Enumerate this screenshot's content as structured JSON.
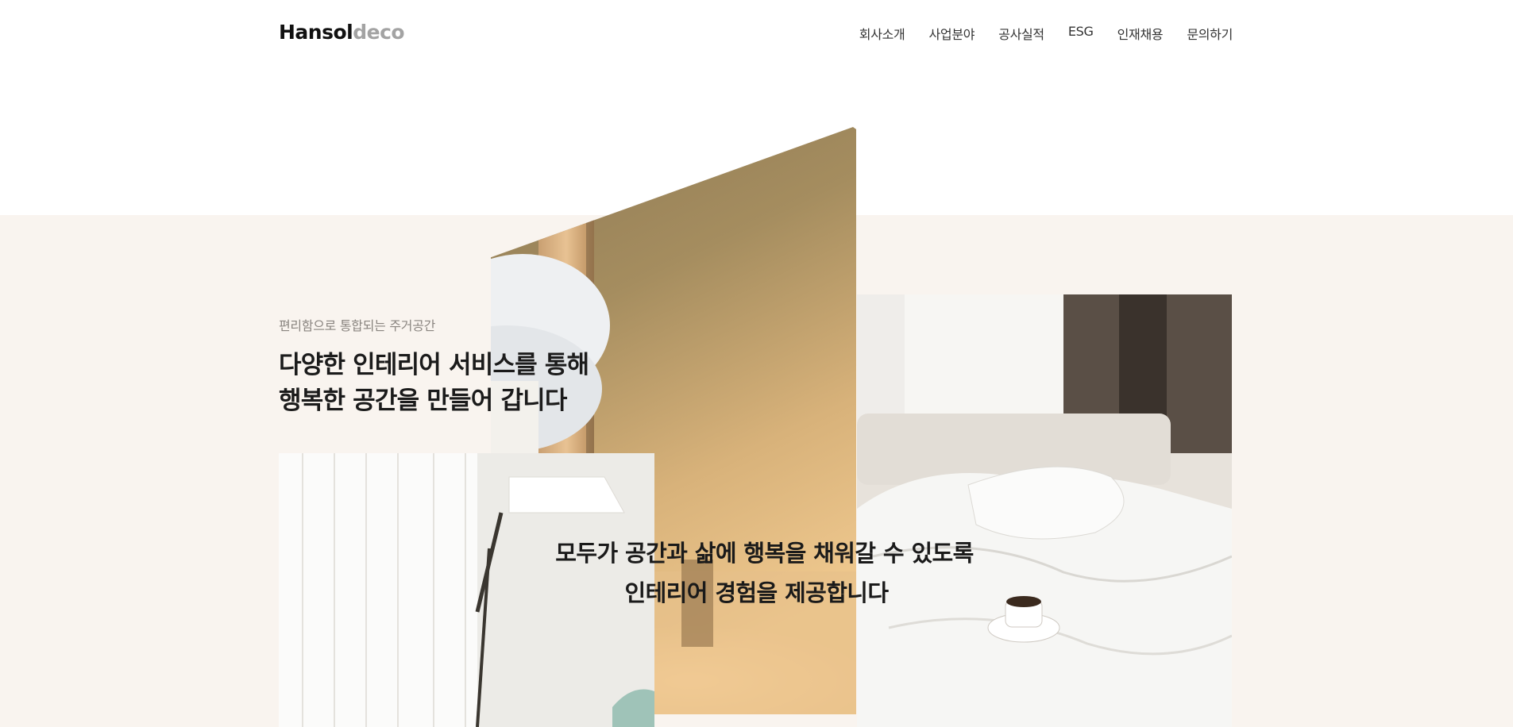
{
  "header": {
    "logo": {
      "strong": "Hansol",
      "light": "deco"
    },
    "nav": [
      {
        "label": "회사소개"
      },
      {
        "label": "사업분야"
      },
      {
        "label": "공사실적"
      },
      {
        "label": "ESG"
      },
      {
        "label": "인재채용"
      },
      {
        "label": "문의하기"
      }
    ]
  },
  "hero": {
    "eyebrow": "편리함으로 통합되는 주거공간",
    "headline": [
      "다양한 인테리어 서비스를 통해",
      "행복한 공간을 만들어 갑니다"
    ],
    "overlay": [
      "모두가 공간과 삶에 행복을 채워갈 수 있도록",
      "인테리어 경험을 제공합니다"
    ]
  },
  "colors": {
    "band": "#f9f4ef",
    "logo_light": "#a3a3a3",
    "text_dark": "#1b1b1b",
    "eyebrow": "#8a8580"
  }
}
